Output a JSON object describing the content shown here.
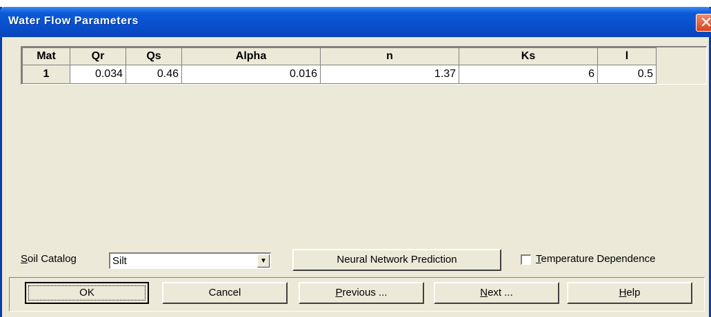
{
  "window": {
    "title": "Water Flow Parameters",
    "close_label": "✕"
  },
  "grid": {
    "columns": [
      "Mat",
      "Qr",
      "Qs",
      "Alpha",
      "n",
      "Ks",
      "l"
    ],
    "rows": [
      [
        "1",
        "0.034",
        "0.46",
        "0.016",
        "1.37",
        "6",
        "0.5"
      ]
    ]
  },
  "soil_catalog": {
    "label_prefix": "S",
    "label_rest": "oil Catalog",
    "value": "Silt"
  },
  "neural_button": {
    "label": "Neural Network Prediction"
  },
  "temperature": {
    "label_prefix": "T",
    "label_rest": "emperature Dependence",
    "checked": false
  },
  "buttons": {
    "ok": "OK",
    "cancel": "Cancel",
    "previous_prefix": "P",
    "previous_rest": "revious ...",
    "next_prefix": "N",
    "next_rest": "ext ...",
    "help_prefix": "H",
    "help_rest": "elp"
  },
  "colors": {
    "titlebar": "#0a4fcf",
    "dialog_bg": "#ece9d8"
  }
}
